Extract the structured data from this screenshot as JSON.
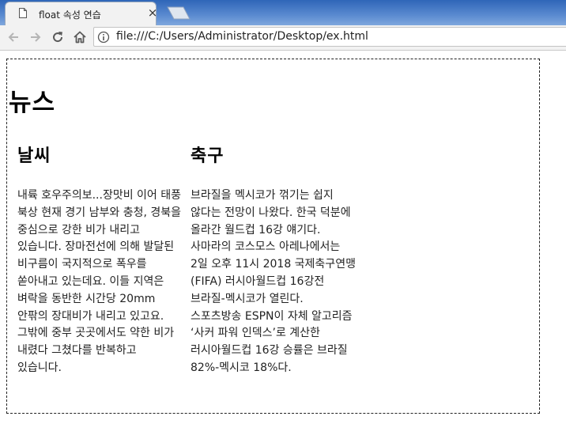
{
  "browser": {
    "tab_title": "float 속성 연습",
    "tab_close_glyph": "×",
    "url": "file:///C:/Users/Administrator/Desktop/ex.html"
  },
  "page": {
    "heading": "뉴스",
    "columns": [
      {
        "title": "날씨",
        "text": "내륙 호우주의보...장맛비 이어 태풍 북상 현재 경기 남부와 충청, 경북을 중심으로 강한 비가 내리고 있습니다. 장마전선에 의해 발달된 비구름이 국지적으로 폭우를 쏟아내고 있는데요. 이들 지역은 벼락을 동반한 시간당 20mm 안팎의 장대비가 내리고 있고요. 그밖에 중부 곳곳에서도 약한 비가 내렸다 그쳤다를 반복하고 있습니다."
      },
      {
        "title": "축구",
        "text": "브라질을 멕시코가 꺾기는 쉽지 않다는 전망이 나왔다. 한국 덕분에 올라간 월드컵 16강 얘기다. 사마라의 코스모스 아레나에서는 2일 오후 11시 2018 국제축구연맹(FIFA) 러시아월드컵 16강전 브라질-멕시코가 열린다. 스포츠방송 ESPN이 자체 알고리즘 ‘사커 파워 인덱스’로 계산한 러시아월드컵 16강 승률은 브라질 82%-멕시코 18%다."
      }
    ]
  }
}
